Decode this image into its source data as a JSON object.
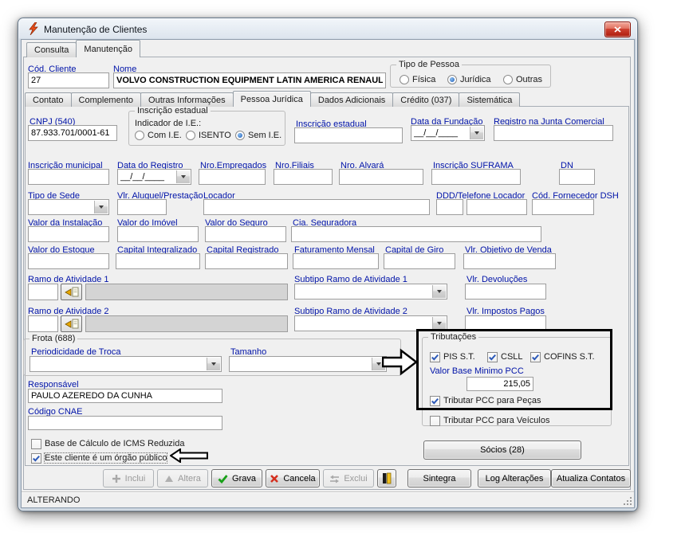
{
  "window": {
    "title": "Manutenção de Clientes",
    "status": "ALTERANDO"
  },
  "colors": {
    "label_blue": "#0013a8",
    "dialog_bg": "#f0f0f0",
    "grava_green": "#18a018",
    "cancela_red": "#d42f1f",
    "close_button_red": "#ce4030",
    "annotation_black": "#000000",
    "checkbox_check_blue": "#2b58b8"
  },
  "main_tabs": {
    "consulta": "Consulta",
    "manutencao": "Manutenção"
  },
  "detail_tabs": {
    "contato": "Contato",
    "complemento": "Complemento",
    "outras_informacoes": "Outras Informações",
    "pessoa_juridica": "Pessoa Jurídica",
    "dados_adicionais": "Dados Adicionais",
    "credito": "Crédito (037)",
    "sistematica": "Sistemática"
  },
  "header": {
    "cod_cliente": {
      "label": "Cód. Cliente",
      "value": "27"
    },
    "nome": {
      "label": "Nome",
      "value": "VOLVO CONSTRUCTION EQUIPMENT LATIN AMERICA RENAULT"
    },
    "tipo_pessoa": {
      "legend": "Tipo de Pessoa",
      "fisica": "Física",
      "juridica": "Jurídica",
      "outras": "Outras"
    }
  },
  "fields": {
    "cnpj": {
      "label": "CNPJ (540)",
      "value": "87.933.701/0001-61"
    },
    "inscricao_estadual_group": {
      "legend": "Inscrição estadual",
      "indicador_label": "Indicador de I.E.:",
      "com_ie": "Com I.E.",
      "isento": "ISENTO",
      "sem_ie": "Sem I.E."
    },
    "inscricao_estadual": {
      "label": "Inscrição estadual",
      "value": ""
    },
    "data_fundacao": {
      "label": "Data da Fundação",
      "value": "__/__/____"
    },
    "registro_junta": {
      "label": "Registro na Junta Comercial",
      "value": ""
    },
    "inscricao_municipal": {
      "label": "Inscrição municipal",
      "value": ""
    },
    "data_registro": {
      "label": "Data do Registro",
      "value": "__/__/____"
    },
    "nro_empregados": {
      "label": "Nro.Empregados",
      "value": ""
    },
    "nro_filiais": {
      "label": "Nro.Filiais",
      "value": ""
    },
    "nro_alvara": {
      "label": "Nro. Alvará",
      "value": ""
    },
    "inscricao_suframa": {
      "label": "Inscrição SUFRAMA",
      "value": ""
    },
    "dn": {
      "label": "DN",
      "value": ""
    },
    "tipo_sede": {
      "label": "Tipo de Sede",
      "value": ""
    },
    "vlr_aluguel": {
      "label": "Vlr. Aluguel/Prestação",
      "value": ""
    },
    "locador": {
      "label": "Locador",
      "value": ""
    },
    "ddd_telefone_locador": {
      "label": "DDD/Telefone Locador",
      "ddd": "",
      "telefone": ""
    },
    "cod_fornecedor_dsh": {
      "label": "Cód. Fornecedor DSH",
      "value": ""
    },
    "valor_instalacao": {
      "label": "Valor da Instalação",
      "value": ""
    },
    "valor_imovel": {
      "label": "Valor do Imóvel",
      "value": ""
    },
    "valor_seguro": {
      "label": "Valor do Seguro",
      "value": ""
    },
    "cia_seguradora": {
      "label": "Cia. Seguradora",
      "value": ""
    },
    "valor_estoque": {
      "label": "Valor do Estoque",
      "value": ""
    },
    "capital_integralizado": {
      "label": "Capital Integralizado",
      "value": ""
    },
    "capital_registrado": {
      "label": "Capital Registrado",
      "value": ""
    },
    "faturamento_mensal": {
      "label": "Faturamento Mensal",
      "value": ""
    },
    "capital_giro": {
      "label": "Capital de Giro",
      "value": ""
    },
    "vlr_objetivo_venda": {
      "label": "Vlr. Objetivo de Venda",
      "value": ""
    },
    "ramo_atividade_1": {
      "label": "Ramo de Atividade 1",
      "code": "",
      "description": ""
    },
    "subtipo_ramo_1": {
      "label": "Subtipo Ramo de Atividade 1",
      "value": ""
    },
    "vlr_devolucoes": {
      "label": "Vlr. Devoluções",
      "value": ""
    },
    "ramo_atividade_2": {
      "label": "Ramo de Atividade 2",
      "code": "",
      "description": ""
    },
    "subtipo_ramo_2": {
      "label": "Subtipo Ramo de Atividade 2",
      "value": ""
    },
    "vlr_impostos_pagos": {
      "label": "Vlr. Impostos Pagos",
      "value": ""
    },
    "frota": {
      "legend": "Frota (688)",
      "periodicidade_label": "Periodicidade de Troca",
      "periodicidade_value": "",
      "tamanho_label": "Tamanho",
      "tamanho_value": ""
    },
    "tributacoes": {
      "legend": "Tributações",
      "pis": "PIS S.T.",
      "csll": "CSLL",
      "cofins": "COFINS S.T.",
      "valor_base_label": "Valor Base Minimo PCC",
      "valor_base_value": "215,05",
      "tributar_pecas": "Tributar PCC para Peças",
      "tributar_veiculos": "Tributar PCC para Veículos"
    },
    "responsavel": {
      "label": "Responsável",
      "value": "PAULO AZEREDO DA CUNHA"
    },
    "codigo_cnae": {
      "label": "Código CNAE",
      "value": ""
    },
    "icms_reduzida_label": "Base de Cálculo de ICMS Reduzida",
    "orgao_publico_label": "Este cliente é um órgão público"
  },
  "states": {
    "fisica": false,
    "juridica": true,
    "outras": false,
    "com_ie": false,
    "isento": false,
    "sem_ie": true,
    "pis_st": true,
    "csll": true,
    "cofins_st": true,
    "tributar_pecas": true,
    "tributar_veiculos": false,
    "icms_reduzida": false,
    "orgao_publico": true
  },
  "buttons": {
    "socios": "Sócios (28)",
    "inclui": "Inclui",
    "altera": "Altera",
    "grava": "Grava",
    "cancela": "Cancela",
    "exclui": "Exclui",
    "sintegra": "Sintegra",
    "log_alteracoes": "Log Alterações",
    "atualiza_contatos": "Atualiza Contatos"
  },
  "icons": {
    "titlebar": "lightning-icon",
    "close": "close-icon",
    "combo": "chevron-down-icon",
    "ramo_lookup": "lookup-icon",
    "inclui": "plus-icon",
    "altera": "triangle-icon",
    "grava": "check-icon",
    "cancela": "x-icon",
    "exclui": "swap-arrows-icon",
    "small_button": "book-icon",
    "statusbar": "resize-grip-icon"
  }
}
